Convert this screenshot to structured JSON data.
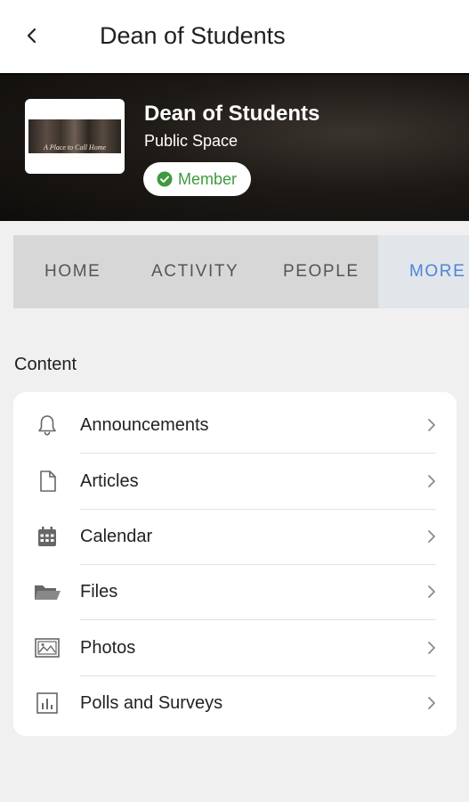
{
  "header": {
    "title": "Dean of Students",
    "back_icon": "chevron-left-icon"
  },
  "hero": {
    "title": "Dean of Students",
    "subtitle": "Public Space",
    "thumbnail_caption": "A Place to Call Home",
    "badge": {
      "label": "Member",
      "icon": "check-circle-icon",
      "color": "#3f9a3f"
    }
  },
  "tabs": [
    {
      "label": "HOME"
    },
    {
      "label": "ACTIVITY"
    },
    {
      "label": "PEOPLE"
    },
    {
      "label": "MORE",
      "active": true
    }
  ],
  "accent_color": "#4a86d8",
  "content": {
    "section_title": "Content",
    "items": [
      {
        "label": "Announcements",
        "icon": "bell-icon"
      },
      {
        "label": "Articles",
        "icon": "document-icon"
      },
      {
        "label": "Calendar",
        "icon": "calendar-icon"
      },
      {
        "label": "Files",
        "icon": "folder-icon"
      },
      {
        "label": "Photos",
        "icon": "image-icon"
      },
      {
        "label": "Polls and Surveys",
        "icon": "bar-chart-icon"
      }
    ]
  }
}
